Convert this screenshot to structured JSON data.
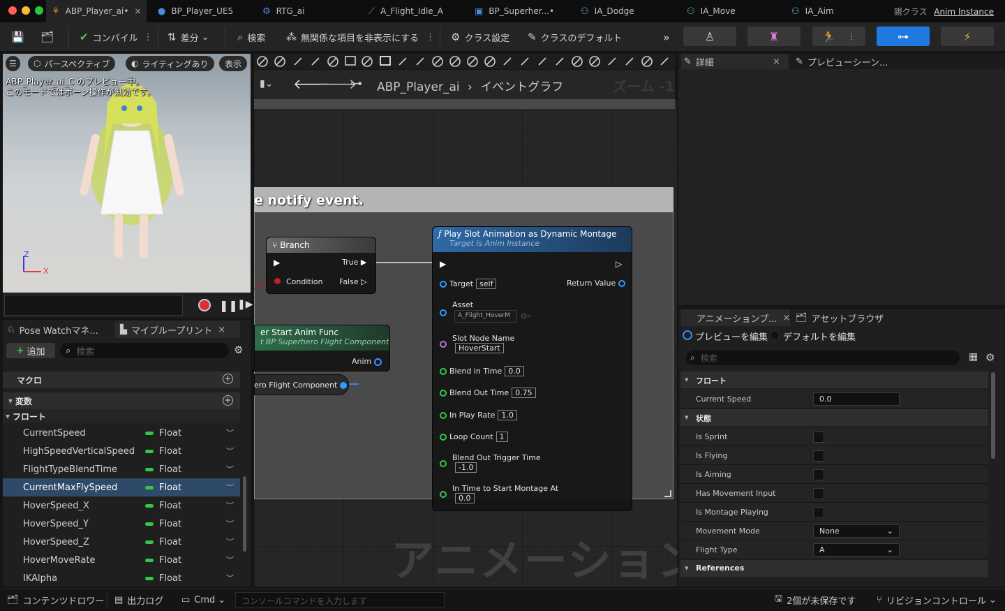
{
  "window": {
    "traffic_colors": [
      "#ff5f57",
      "#febc2e",
      "#28c840"
    ]
  },
  "tabs": [
    {
      "label": "ABP_Player_ai•",
      "icon": "anim-blueprint-icon",
      "active": true
    },
    {
      "label": "BP_Player_UE5",
      "icon": "character-icon"
    },
    {
      "label": "RTG_ai",
      "icon": "retarget-icon"
    },
    {
      "label": "A_Flight_Idle_A",
      "icon": "anim-sequence-icon"
    },
    {
      "label": "BP_Superher...•",
      "icon": "blueprint-icon"
    },
    {
      "label": "IA_Dodge",
      "icon": "input-action-icon"
    },
    {
      "label": "IA_Move",
      "icon": "input-action-icon"
    },
    {
      "label": "IA_Aim",
      "icon": "input-action-icon"
    }
  ],
  "parent_class": {
    "label": "親クラス",
    "value": "Anim Instance"
  },
  "toolbar": {
    "compile": "コンパイル",
    "diff": "差分",
    "search": "検索",
    "hide_unrelated": "無関係な項目を非表示にする",
    "class_settings": "クラス設定",
    "class_defaults": "クラスのデフォルト"
  },
  "viewport": {
    "perspective": "パースペクティブ",
    "lighting": "ライティングあり",
    "show": "表示",
    "message_line1": "ABP_Player_ai_C のプレビュー中。",
    "message_line2": "このモードではボーン操作が無効です。",
    "axis_z": "Z",
    "axis_x": "X"
  },
  "graph": {
    "breadcrumb_root": "ABP_Player_ai",
    "breadcrumb_leaf": "イベントグラフ",
    "zoom": "ズーム -1",
    "comment": "e notify event.",
    "watermark": "アニメーション"
  },
  "branch_node": {
    "title": "Branch",
    "true_label": "True",
    "condition": "Condition",
    "false_label": "False"
  },
  "func_node": {
    "title": "er Start Anim Func",
    "subtitle": "t BP Superhero Flight Component",
    "anim": "Anim"
  },
  "comp_node": {
    "label": "ero Flight Component"
  },
  "play_node": {
    "title": "Play Slot Animation as Dynamic Montage",
    "subtitle": "Target is Anim Instance",
    "target": "Target",
    "target_val": "self",
    "return_value": "Return Value",
    "asset": "Asset",
    "asset_val": "A_Flight_HoverM",
    "slot": "Slot Node Name",
    "slot_val": "HoverStart",
    "blend_in": "Blend in Time",
    "blend_in_val": "0.0",
    "blend_out": "Blend Out Time",
    "blend_out_val": "0.75",
    "play_rate": "In Play Rate",
    "play_rate_val": "1.0",
    "loop": "Loop Count",
    "loop_val": "1",
    "trigger": "Blend Out Trigger Time",
    "trigger_val": "-1.0",
    "start_at": "In Time to Start Montage At",
    "start_at_val": "0.0"
  },
  "left_panel": {
    "tab1": "Pose Watchマネ...",
    "tab2": "マイブループリント",
    "add": "追加",
    "search_placeholder": "検索",
    "macro": "マクロ",
    "variables": "変数",
    "float_section": "フロート",
    "vars": [
      {
        "name": "CurrentSpeed",
        "type": "Float"
      },
      {
        "name": "HighSpeedVerticalSpeed",
        "type": "Float"
      },
      {
        "name": "FlightTypeBlendTime",
        "type": "Float"
      },
      {
        "name": "CurrentMaxFlySpeed",
        "type": "Float",
        "selected": true
      },
      {
        "name": "HoverSpeed_X",
        "type": "Float"
      },
      {
        "name": "HoverSpeed_Y",
        "type": "Float"
      },
      {
        "name": "HoverSpeed_Z",
        "type": "Float"
      },
      {
        "name": "HoverMoveRate",
        "type": "Float"
      },
      {
        "name": "IKAlpha",
        "type": "Float"
      }
    ]
  },
  "details": {
    "tab1": "詳細",
    "tab2": "プレビューシーン..."
  },
  "preview_panel": {
    "tab1": "アニメーションプ...",
    "tab2": "アセットブラウザ",
    "edit_preview": "プレビューを編集",
    "edit_defaults": "デフォルトを編集",
    "search_placeholder": "検索",
    "float_section": "フロート",
    "current_speed": "Current Speed",
    "current_speed_val": "0.0",
    "state_section": "状態",
    "is_sprint": "Is Sprint",
    "is_flying": "Is Flying",
    "is_aiming": "Is Aiming",
    "has_movement_input": "Has Movement Input",
    "is_montage_playing": "Is Montage Playing",
    "movement_mode": "Movement Mode",
    "movement_mode_val": "None",
    "flight_type": "Flight Type",
    "flight_type_val": "A",
    "references": "References"
  },
  "statusbar": {
    "content_drawer": "コンテンツドロワー",
    "output_log": "出力ログ",
    "cmd": "Cmd",
    "console_placeholder": "コンソールコマンドを入力します",
    "unsaved": "2個が未保存です",
    "revision": "リビジョンコントロール"
  }
}
